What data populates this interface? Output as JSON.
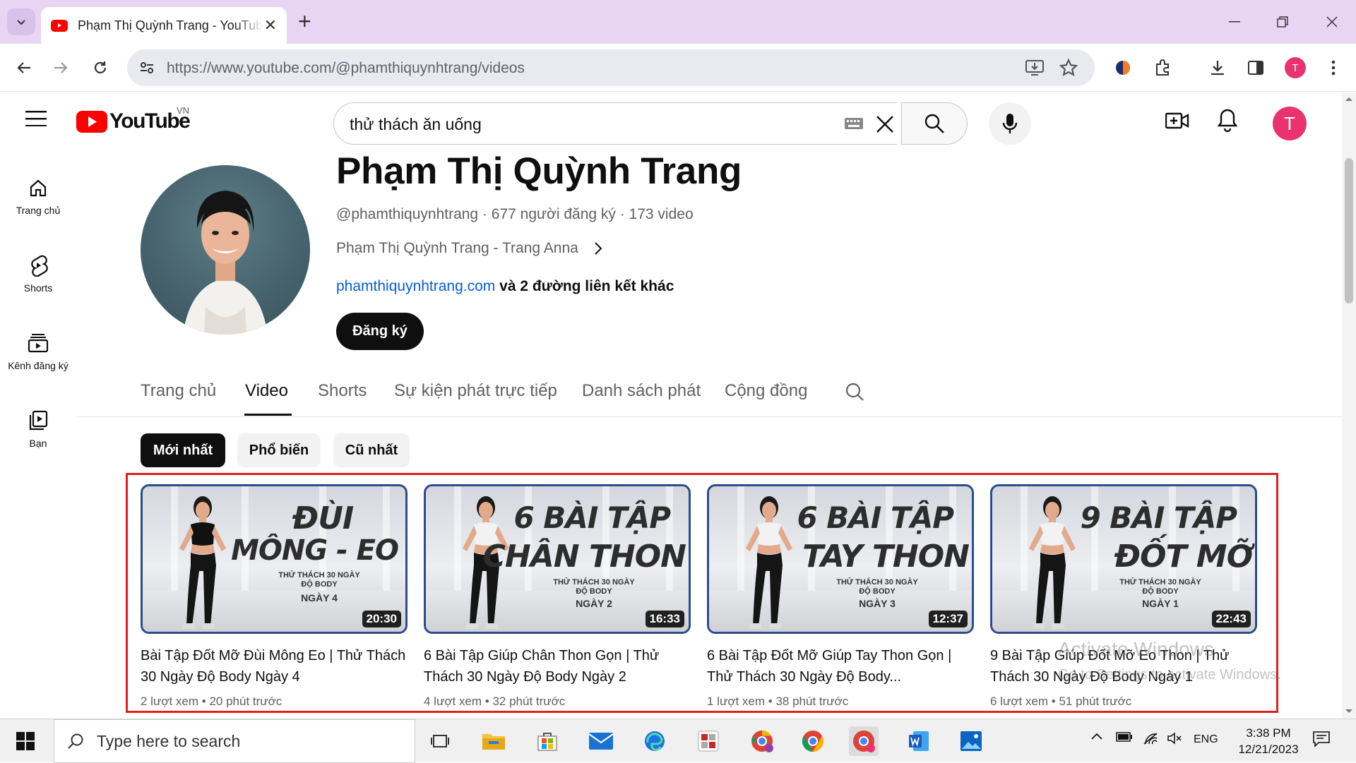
{
  "browser": {
    "tab_title": "Phạm Thị Quỳnh Trang - YouTube",
    "url": "https://www.youtube.com/@phamthiquynhtrang/videos",
    "profile_initial": "T"
  },
  "youtube": {
    "logo_text": "YouTube",
    "region": "VN",
    "search_value": "thử thách ăn uống",
    "avatar_initial": "T"
  },
  "guide": [
    {
      "label": "Trang chủ",
      "icon": "home-icon"
    },
    {
      "label": "Shorts",
      "icon": "shorts-icon"
    },
    {
      "label": "Kênh đăng ký",
      "icon": "subscriptions-icon"
    },
    {
      "label": "Bạn",
      "icon": "you-icon"
    }
  ],
  "channel": {
    "name": "Phạm Thị Quỳnh Trang",
    "meta": "@phamthiquynhtrang · 677 người đăng ký · 173 video",
    "description": "Phạm Thị Quỳnh Trang - Trang Anna",
    "link": "phamthiquynhtrang.com",
    "link_suffix": " và 2 đường liên kết khác",
    "subscribe_label": "Đăng ký"
  },
  "tabs": [
    "Trang chủ",
    "Video",
    "Shorts",
    "Sự kiện phát trực tiếp",
    "Danh sách phát",
    "Cộng đồng"
  ],
  "active_tab": "Video",
  "chips": [
    "Mới nhất",
    "Phổ biến",
    "Cũ nhất"
  ],
  "active_chip": "Mới nhất",
  "videos": [
    {
      "thumb_line1": "ĐÙI",
      "thumb_line2": "MÔNG - EO",
      "thumb_sub": "THỬ THÁCH 30 NGÀY ĐỘ BODY",
      "thumb_day": "NGÀY 4",
      "duration": "20:30",
      "title": "Bài Tập Đốt Mỡ Đùi Mông Eo | Thử Thách 30 Ngày Độ Body Ngày 4",
      "views": "2 lượt xem",
      "age": "20 phút trước"
    },
    {
      "thumb_line1": "6 BÀI TẬP",
      "thumb_line2": "CHÂN THON",
      "thumb_sub": "THỬ THÁCH 30 NGÀY ĐỘ BODY",
      "thumb_day": "NGÀY 2",
      "duration": "16:33",
      "title": "6 Bài Tập Giúp Chân Thon Gọn | Thử Thách 30 Ngày Độ Body Ngày 2",
      "views": "4 lượt xem",
      "age": "32 phút trước"
    },
    {
      "thumb_line1": "6 BÀI TẬP",
      "thumb_line2": "TAY THON",
      "thumb_sub": "THỬ THÁCH 30 NGÀY ĐỘ BODY",
      "thumb_day": "NGÀY 3",
      "duration": "12:37",
      "title": "6 Bài Tập Đốt Mỡ Giúp Tay Thon Gọn | Thử Thách 30 Ngày Độ Body...",
      "views": "1 lượt xem",
      "age": "38 phút trước"
    },
    {
      "thumb_line1": "9 BÀI TẬP",
      "thumb_line2": "ĐỐT MỠ",
      "thumb_sub": "THỬ THÁCH 30 NGÀY ĐỘ BODY",
      "thumb_day": "NGÀY 1",
      "duration": "22:43",
      "title": "9 Bài Tập Giúp Đốt Mỡ Eo Thon | Thử Thách 30 Ngày Độ Body Ngày 1",
      "views": "6 lượt xem",
      "age": "51 phút trước"
    }
  ],
  "watermark": {
    "line1": "Activate Windows",
    "line2": "Go to Settings to activate Windows."
  },
  "taskbar": {
    "search_placeholder": "Type here to search",
    "language": "ENG",
    "time": "3:38 PM",
    "date": "12/21/2023"
  },
  "colors": {
    "youtube_red": "#ff0000",
    "avatar_pink": "#e8336e",
    "link_blue": "#065fd4",
    "highlight_red": "#e0201f",
    "tabstrip": "#e8d5f4"
  }
}
